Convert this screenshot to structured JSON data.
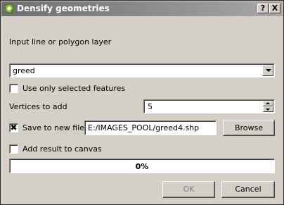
{
  "window": {
    "title": "Densify geometries",
    "help_label": "?",
    "close_label": "X"
  },
  "form": {
    "input_layer_label": "Input line or polygon layer",
    "layer_selected": "greed",
    "use_selected_label": "Use only selected features",
    "use_selected_checked": false,
    "vertices_label": "Vertices to add",
    "vertices_value": "5",
    "save_label": "Save to new file",
    "save_checked": true,
    "save_checkmark": "✖",
    "output_path": "E:/IMAGES_POOL/greed4.shp",
    "browse_label": "Browse",
    "add_to_canvas_label": "Add result to canvas",
    "add_to_canvas_checked": false
  },
  "progress": {
    "value": 0,
    "text": "0%"
  },
  "buttons": {
    "ok_label": "OK",
    "ok_enabled": false,
    "cancel_label": "Cancel"
  },
  "colors": {
    "dialog_bg": "#d4d0c8",
    "titlebar_start": "#6e6e6e",
    "titlebar_end": "#a7a7a7",
    "app_icon_green": "#8bbf3c"
  },
  "icons": {
    "app": "qgis-logo-icon",
    "help": "help-icon",
    "close": "close-icon"
  }
}
